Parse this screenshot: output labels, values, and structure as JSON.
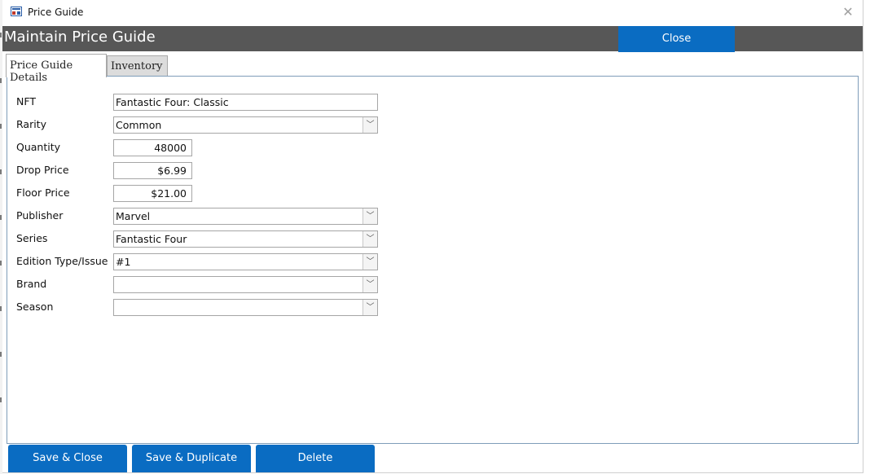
{
  "window": {
    "title": "Price Guide",
    "app_icon": "form-icon",
    "close_icon": "close-icon"
  },
  "header": {
    "title": "Maintain Price Guide",
    "close_label": "Close"
  },
  "tabs": [
    {
      "label": "Price Guide Details",
      "active": true
    },
    {
      "label": "Inventory",
      "active": false
    }
  ],
  "fields": {
    "nft": {
      "label": "NFT",
      "value": "Fantastic Four: Classic"
    },
    "rarity": {
      "label": "Rarity",
      "value": "Common"
    },
    "quantity": {
      "label": "Quantity",
      "value": "48000"
    },
    "drop_price": {
      "label": "Drop Price",
      "value": "$6.99"
    },
    "floor_price": {
      "label": "Floor Price",
      "value": "$21.00"
    },
    "publisher": {
      "label": "Publisher",
      "value": "Marvel"
    },
    "series": {
      "label": "Series",
      "value": "Fantastic Four"
    },
    "edition": {
      "label": "Edition Type/Issue",
      "value": "#1"
    },
    "brand": {
      "label": "Brand",
      "value": ""
    },
    "season": {
      "label": "Season",
      "value": ""
    }
  },
  "footer": {
    "save_close": "Save & Close",
    "save_duplicate": "Save & Duplicate",
    "delete": "Delete"
  },
  "colors": {
    "accent": "#0a6cc2",
    "header_band": "#575757"
  }
}
